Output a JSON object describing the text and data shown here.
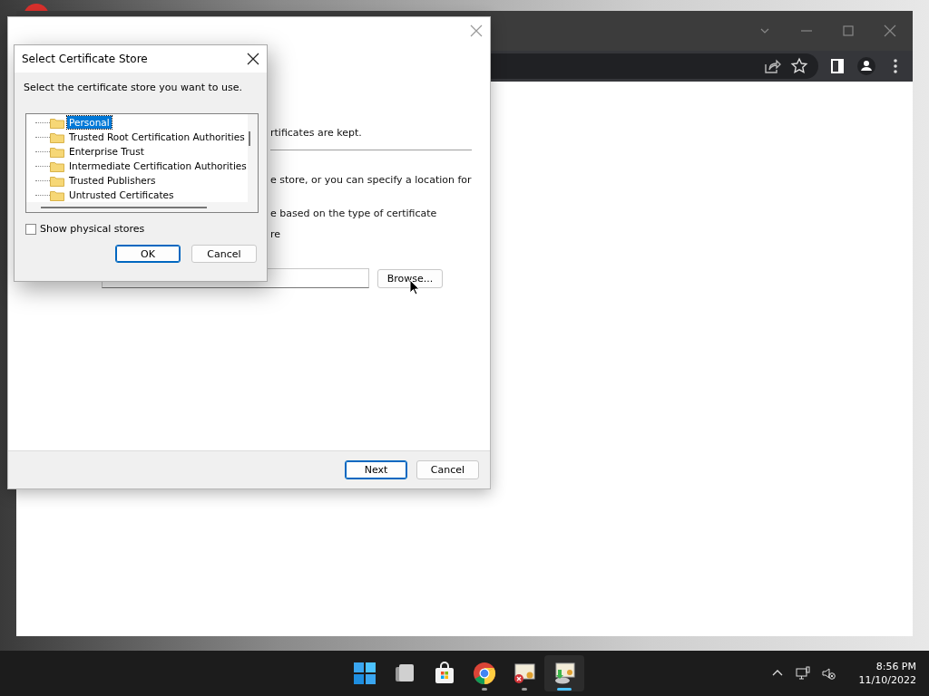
{
  "wizard": {
    "partial_lines": [
      "rtificates are kept.",
      "e store, or you can specify a location for",
      "e based on the type of certificate",
      "re"
    ],
    "browse_button": "Browse...",
    "buttons": [
      {
        "label": "Next",
        "default": true
      },
      {
        "label": "Cancel",
        "default": false
      }
    ]
  },
  "store_dialog": {
    "title": "Select Certificate Store",
    "prompt": "Select the certificate store you want to use.",
    "stores": [
      {
        "label": "Personal",
        "selected": true
      },
      {
        "label": "Trusted Root Certification Authorities",
        "selected": false
      },
      {
        "label": "Enterprise Trust",
        "selected": false
      },
      {
        "label": "Intermediate Certification Authorities",
        "selected": false
      },
      {
        "label": "Trusted Publishers",
        "selected": false
      },
      {
        "label": "Untrusted Certificates",
        "selected": false
      }
    ],
    "show_physical_stores": {
      "label": "Show physical stores",
      "checked": false
    },
    "buttons": [
      {
        "label": "OK",
        "default": true
      },
      {
        "label": "Cancel",
        "default": false
      }
    ]
  },
  "taskbar": {
    "apps": [
      {
        "kind": "start",
        "running": false,
        "active": false
      },
      {
        "kind": "files",
        "running": false,
        "active": false
      },
      {
        "kind": "store",
        "running": false,
        "active": false
      },
      {
        "kind": "chrome",
        "running": true,
        "active": false
      },
      {
        "kind": "cert-error",
        "running": true,
        "active": false
      },
      {
        "kind": "cert-import",
        "running": true,
        "active": true
      }
    ],
    "clock": {
      "time": "8:56 PM",
      "date": "11/10/2022"
    }
  }
}
